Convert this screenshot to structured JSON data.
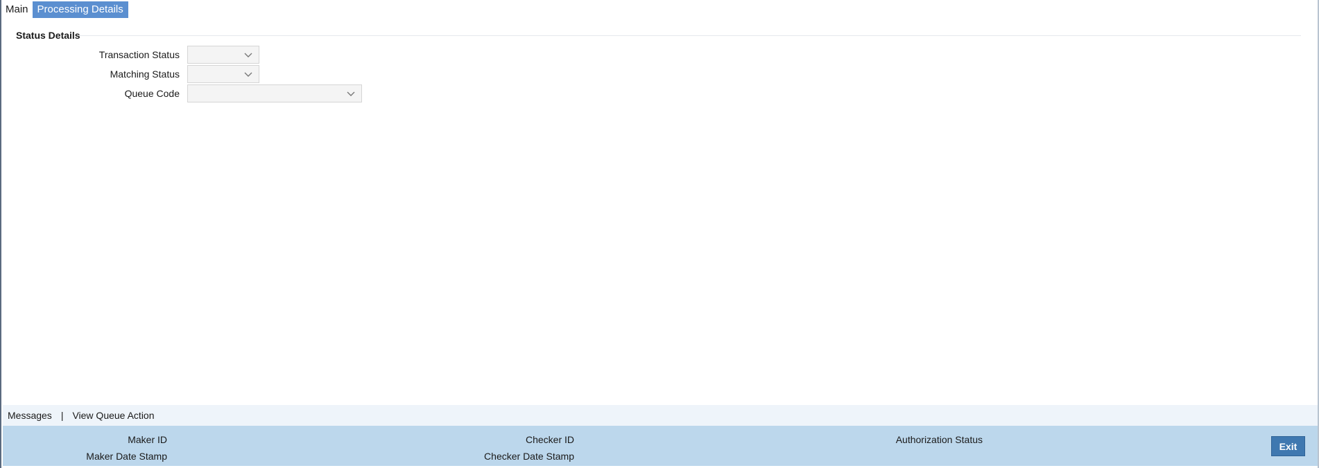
{
  "tabs": [
    {
      "label": "Main",
      "active": false
    },
    {
      "label": "Processing Details",
      "active": true
    }
  ],
  "section": {
    "title": "Status Details"
  },
  "fields": {
    "transaction_status": {
      "label": "Transaction Status",
      "value": ""
    },
    "matching_status": {
      "label": "Matching Status",
      "value": ""
    },
    "queue_code": {
      "label": "Queue Code",
      "value": ""
    }
  },
  "links": {
    "messages": "Messages",
    "separator": "|",
    "view_queue_action": "View Queue Action"
  },
  "footer": {
    "maker_id": "Maker ID",
    "maker_date_stamp": "Maker Date Stamp",
    "checker_id": "Checker ID",
    "checker_date_stamp": "Checker Date Stamp",
    "authorization_status": "Authorization Status",
    "exit_label": "Exit"
  },
  "colors": {
    "active_tab": "#5b8fd0",
    "links_bar": "#eef4fa",
    "footer_panel": "#bcd7ec",
    "exit_button": "#3f78b0"
  }
}
